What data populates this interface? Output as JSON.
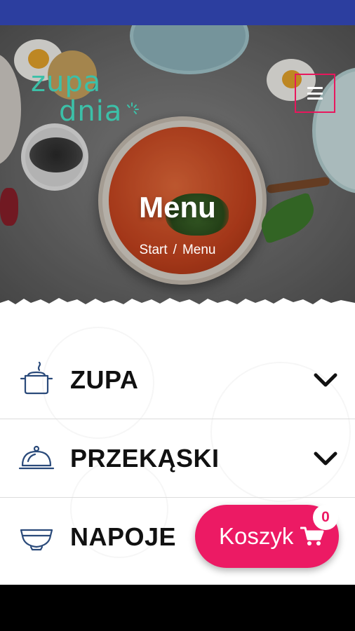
{
  "header": {
    "logo_line1": "zupa",
    "logo_line2": "dnia",
    "menu_icon": "hamburger-icon"
  },
  "hero": {
    "title": "Menu",
    "breadcrumb": {
      "home": "Start",
      "separator": "/",
      "current": "Menu"
    }
  },
  "categories": [
    {
      "label": "ZUPA",
      "icon": "pot-icon"
    },
    {
      "label": "PRZEKĄSKI",
      "icon": "cloche-icon"
    },
    {
      "label": "NAPOJE",
      "icon": "bowl-icon"
    }
  ],
  "cart": {
    "label": "Koszyk",
    "count": "0",
    "icon": "cart-icon"
  },
  "colors": {
    "status_bar": "#2c3e9f",
    "brand_teal": "#3cc0a8",
    "accent_pink": "#ec1a64",
    "toggle_border": "#e8175d"
  }
}
